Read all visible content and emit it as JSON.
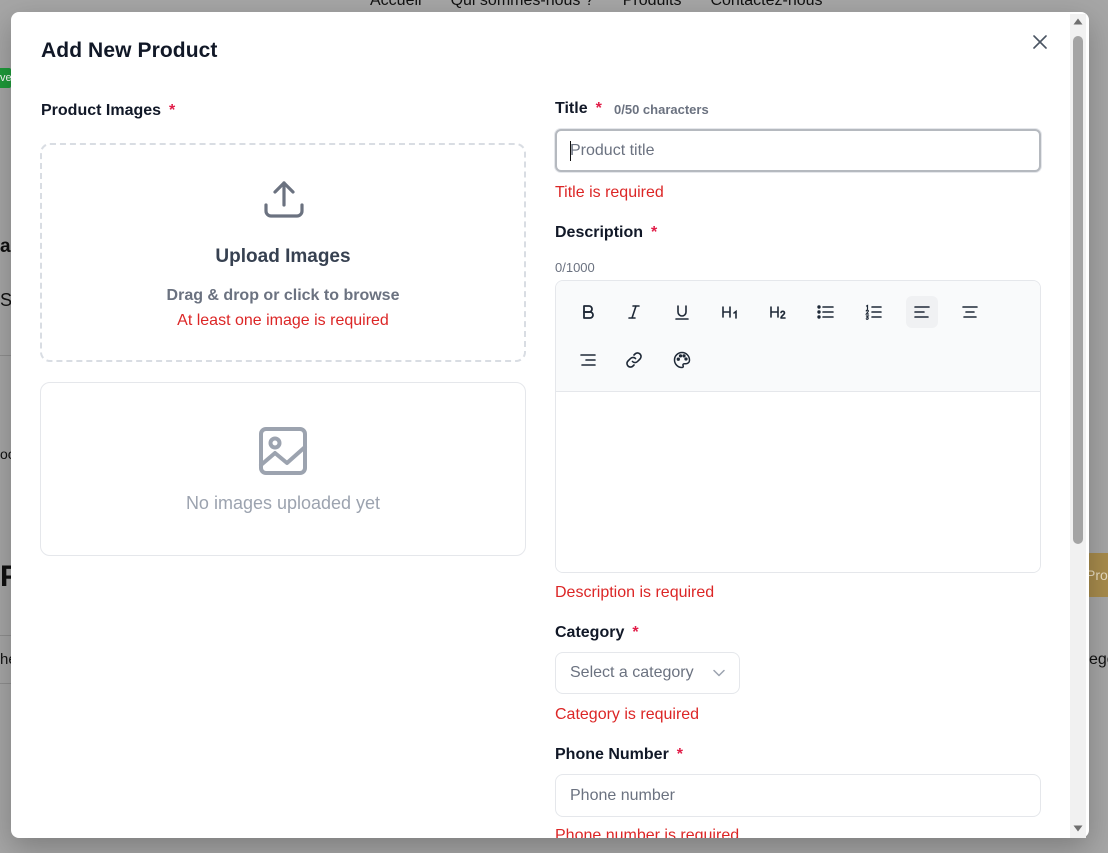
{
  "background": {
    "nav": [
      "Accueil",
      "Qui sommes-nous ?",
      "Produits",
      "Contactez-nous"
    ],
    "badge_text": "ve",
    "fragments": [
      "a",
      "S",
      "oo",
      "Pr",
      "he",
      "Pro",
      "ego"
    ]
  },
  "modal": {
    "title": "Add New Product",
    "close_icon": "close-icon"
  },
  "images": {
    "label": "Product Images",
    "required_mark": "*",
    "upload_title": "Upload Images",
    "upload_subtitle": "Drag & drop or click to browse",
    "upload_error": "At least one image is required",
    "empty_text": "No images uploaded yet"
  },
  "title_field": {
    "label": "Title",
    "required_mark": "*",
    "char_count": "0/50 characters",
    "value": "",
    "placeholder": "Product title",
    "error": "Title is required"
  },
  "description": {
    "label": "Description",
    "required_mark": "*",
    "char_count": "0/1000",
    "error": "Description is required",
    "toolbar": [
      {
        "name": "bold-icon",
        "glyph": "B"
      },
      {
        "name": "italic-icon",
        "glyph": "I"
      },
      {
        "name": "underline-icon",
        "glyph": "U"
      },
      {
        "name": "heading-1-icon",
        "glyph": "H1"
      },
      {
        "name": "heading-2-icon",
        "glyph": "H2"
      },
      {
        "name": "bullet-list-icon",
        "glyph": ""
      },
      {
        "name": "ordered-list-icon",
        "glyph": ""
      },
      {
        "name": "align-left-icon",
        "glyph": "",
        "active": true
      },
      {
        "name": "align-center-icon",
        "glyph": ""
      },
      {
        "name": "align-right-icon",
        "glyph": ""
      },
      {
        "name": "link-icon",
        "glyph": ""
      },
      {
        "name": "palette-icon",
        "glyph": ""
      }
    ]
  },
  "category": {
    "label": "Category",
    "required_mark": "*",
    "selected": "Select a category",
    "error": "Category is required"
  },
  "phone": {
    "label": "Phone Number",
    "required_mark": "*",
    "value": "",
    "placeholder": "Phone number",
    "error": "Phone number is required"
  },
  "colors": {
    "error": "#dc2626",
    "required": "#e11d48",
    "border": "#e5e7eb",
    "badge_green": "#1e9b3a",
    "gold_button": "#a78b4c"
  }
}
